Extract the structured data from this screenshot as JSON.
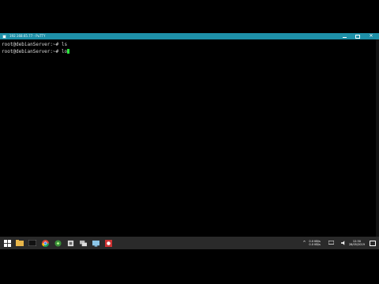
{
  "window": {
    "title": "192.168.65.77 - PuTTY",
    "controls": {
      "minimize": "minimize-icon",
      "maximize": "maximize-icon",
      "close": "close-icon"
    }
  },
  "terminal": {
    "lines": [
      {
        "prompt": "root@debianServer:~#",
        "command": "ls"
      },
      {
        "prompt": "root@debianServer:~#",
        "command": "lo"
      }
    ],
    "cursor_color": "#27e63a"
  },
  "taskbar": {
    "icons": [
      "windows-start-icon",
      "folder-icon",
      "terminal-icon",
      "chrome-icon",
      "network-icon",
      "app-icon",
      "putty-icon",
      "screen-icon",
      "recorder-icon"
    ],
    "tray": {
      "up_rate": "0.0 KB/s",
      "down_rate": "0.0 KB/s",
      "time": "12:30",
      "date": "28/05/2019"
    }
  },
  "colors": {
    "titlebar": "#1e90a8",
    "taskbar": "#2a2a2a"
  }
}
